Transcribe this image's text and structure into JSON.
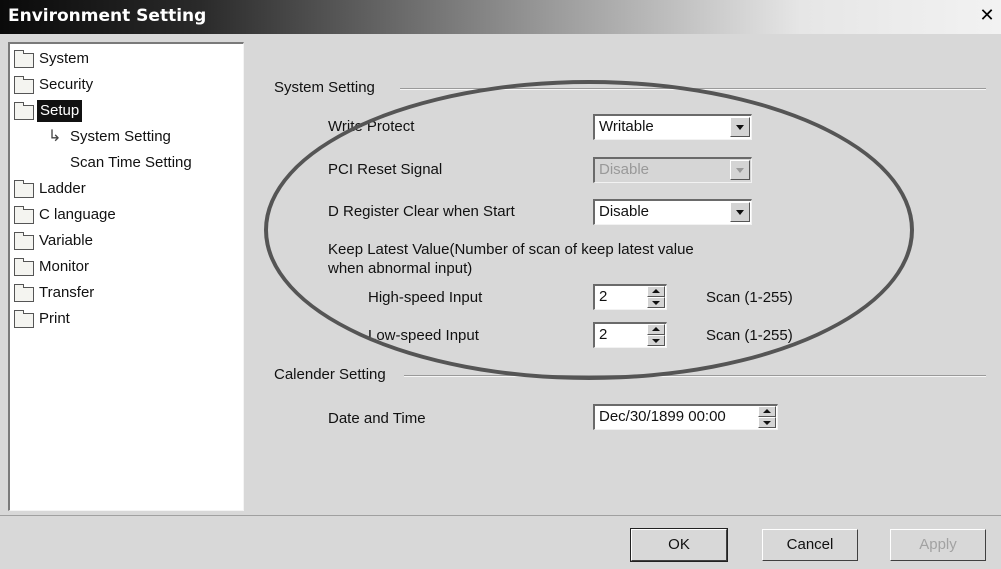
{
  "window": {
    "title": "Environment Setting",
    "close_glyph": "✕"
  },
  "tree": {
    "items": [
      {
        "label": "System"
      },
      {
        "label": "Security"
      },
      {
        "label": "Setup"
      },
      {
        "label": "Ladder"
      },
      {
        "label": "C language"
      },
      {
        "label": "Variable"
      },
      {
        "label": "Monitor"
      },
      {
        "label": "Transfer"
      },
      {
        "label": "Print"
      }
    ],
    "subitems": [
      {
        "label": "System Setting"
      },
      {
        "label": "Scan Time Setting"
      }
    ],
    "selected": "Setup",
    "arrow_glyph": "↳"
  },
  "system_setting": {
    "group_label": "System Setting",
    "write_protect": {
      "label": "Write Protect",
      "value": "Writable"
    },
    "pci_reset": {
      "label": "PCI Reset Signal",
      "value": "Disable",
      "enabled": false
    },
    "d_register": {
      "label": "D Register Clear when Start",
      "value": "Disable"
    },
    "keep_latest": {
      "label_line1": "Keep Latest Value(Number of scan of keep latest value",
      "label_line2": "when abnormal input)"
    },
    "high_speed": {
      "label": "High-speed Input",
      "value": "2",
      "unit": "Scan (1-255)"
    },
    "low_speed": {
      "label": "Low-speed Input",
      "value": "2",
      "unit": "Scan (1-255)"
    }
  },
  "calender_setting": {
    "group_label": "Calender Setting",
    "date_time": {
      "label": "Date and Time",
      "value": "Dec/30/1899 00:00"
    }
  },
  "buttons": {
    "ok": "OK",
    "cancel": "Cancel",
    "apply": "Apply"
  },
  "colors": {
    "titlebar_dark": "#0a0a0a",
    "dialog_bg": "#d8d8d8",
    "annotation_ellipse": "#555555"
  }
}
